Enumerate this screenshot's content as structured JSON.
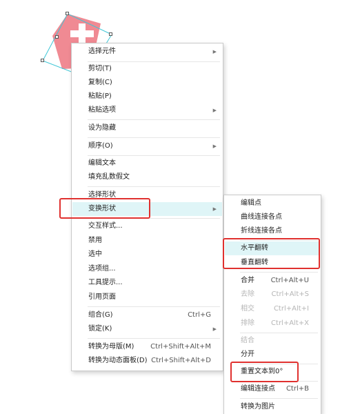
{
  "main_menu": {
    "items": [
      {
        "label": "选择元件",
        "submenu": true
      },
      {
        "label": "剪切(T)"
      },
      {
        "label": "复制(C)"
      },
      {
        "label": "粘贴(P)"
      },
      {
        "label": "粘贴选项",
        "submenu": true
      },
      {
        "label": "设为隐藏"
      },
      {
        "label": "顺序(O)",
        "submenu": true
      },
      {
        "label": "编辑文本"
      },
      {
        "label": "填充乱数假文"
      },
      {
        "label": "选择形状"
      },
      {
        "label": "变换形状",
        "submenu": true
      },
      {
        "label": "交互样式..."
      },
      {
        "label": "禁用"
      },
      {
        "label": "选中"
      },
      {
        "label": "选项组..."
      },
      {
        "label": "工具提示..."
      },
      {
        "label": "引用页面"
      },
      {
        "label": "组合(G)",
        "shortcut": "Ctrl+G"
      },
      {
        "label": "锁定(K)",
        "submenu": true
      },
      {
        "label": "转换为母版(M)",
        "shortcut": "Ctrl+Shift+Alt+M"
      },
      {
        "label": "转换为动态面板(D)",
        "shortcut": "Ctrl+Shift+Alt+D"
      }
    ]
  },
  "sub_menu": {
    "items": [
      {
        "label": "编辑点"
      },
      {
        "label": "曲线连接各点"
      },
      {
        "label": "折线连接各点"
      },
      {
        "label": "水平翻转"
      },
      {
        "label": "垂直翻转"
      },
      {
        "label": "合并",
        "shortcut": "Ctrl+Alt+U"
      },
      {
        "label": "去除",
        "shortcut": "Ctrl+Alt+S"
      },
      {
        "label": "相交",
        "shortcut": "Ctrl+Alt+I"
      },
      {
        "label": "排除",
        "shortcut": "Ctrl+Alt+X"
      },
      {
        "label": "结合"
      },
      {
        "label": "分开"
      },
      {
        "label": "重置文本到0°"
      },
      {
        "label": "编辑连接点",
        "shortcut": "Ctrl+B"
      },
      {
        "label": "转换为图片"
      }
    ]
  },
  "icons": {
    "submenu_arrow": "▶"
  },
  "colors": {
    "highlight": "#dff5f7",
    "annotation": "#e0302e",
    "shape_fill": "#f08a93",
    "selection": "#3ec6d6"
  }
}
